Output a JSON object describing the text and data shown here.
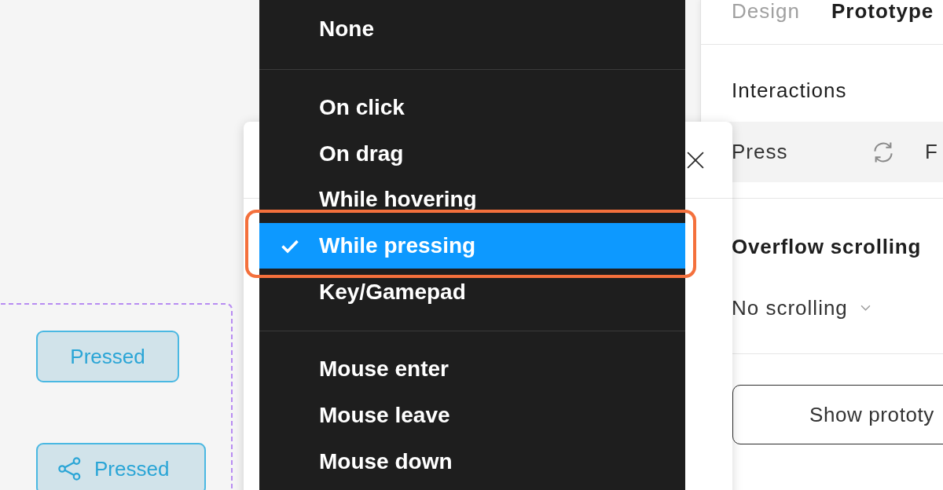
{
  "canvas": {
    "buttons": [
      {
        "label": "Pressed",
        "kind": "plain"
      },
      {
        "label": "Pressed",
        "kind": "with_icon"
      }
    ]
  },
  "trigger_menu": {
    "groups": [
      {
        "items": [
          {
            "label": "None",
            "selected": false
          }
        ]
      },
      {
        "items": [
          {
            "label": "On click",
            "selected": false
          },
          {
            "label": "On drag",
            "selected": false
          },
          {
            "label": "While hovering",
            "selected": false
          },
          {
            "label": "While pressing",
            "selected": true
          },
          {
            "label": "Key/Gamepad",
            "selected": false
          }
        ]
      },
      {
        "items": [
          {
            "label": "Mouse enter",
            "selected": false
          },
          {
            "label": "Mouse leave",
            "selected": false
          },
          {
            "label": "Mouse down",
            "selected": false
          }
        ]
      }
    ]
  },
  "properties_panel": {
    "tabs": [
      {
        "label": "Design",
        "selected": false
      },
      {
        "label": "Prototype",
        "selected": true
      }
    ],
    "interactions": {
      "title": "Interactions",
      "rows": [
        {
          "trigger": "Press",
          "action": "F"
        }
      ]
    },
    "overflow_scrolling": {
      "title": "Overflow scrolling",
      "value": "No scrolling"
    },
    "show_prototype_button": {
      "label": "Show prototy"
    }
  }
}
